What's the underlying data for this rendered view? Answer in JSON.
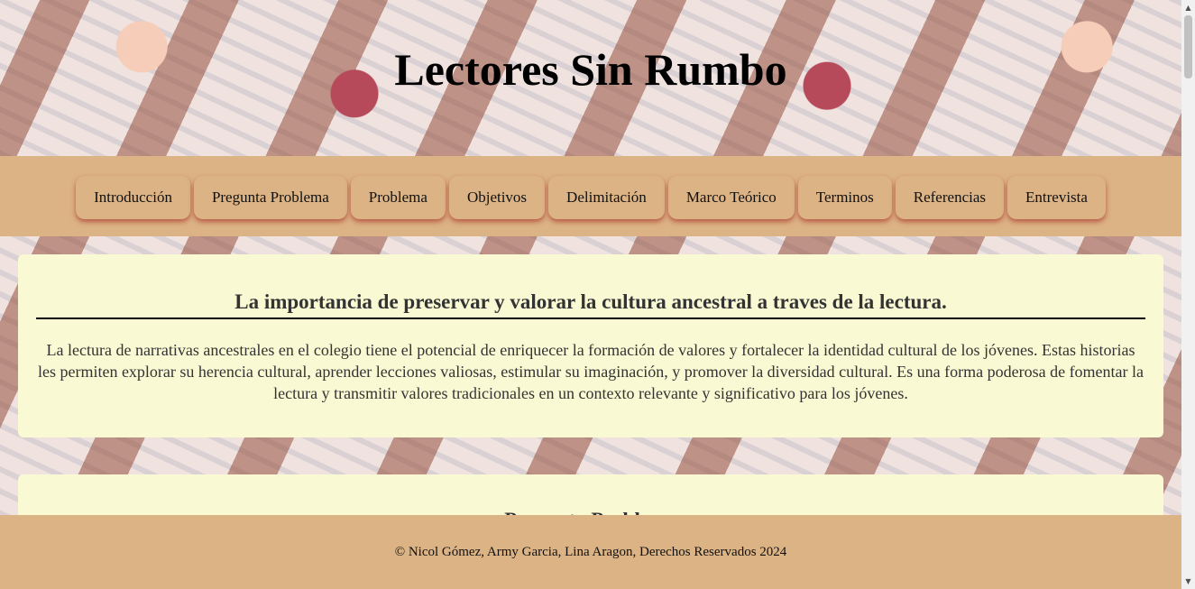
{
  "header": {
    "title": "Lectores Sin Rumbo"
  },
  "nav": {
    "items": [
      "Introducción",
      "Pregunta Problema",
      "Problema",
      "Objetivos",
      "Delimitación",
      "Marco Teórico",
      "Terminos",
      "Referencias",
      "Entrevista"
    ]
  },
  "sections": [
    {
      "heading": "La importancia de preservar y valorar la cultura ancestral a traves de la lectura.",
      "body": "La lectura de narrativas ancestrales en el colegio tiene el potencial de enriquecer la formación de valores y fortalecer la identidad cultural de los jóvenes. Estas historias les permiten explorar su herencia cultural, aprender lecciones valiosas, estimular su imaginación, y promover la diversidad cultural. Es una forma poderosa de fomentar la lectura y transmitir valores tradicionales en un contexto relevante y significativo para los jóvenes."
    },
    {
      "heading": "Pregunta Problema"
    }
  ],
  "footer": {
    "text": "© Nicol Gómez, Army Garcia, Lina Aragon, Derechos Reservados 2024"
  },
  "colors": {
    "nav_background": "#dcb384",
    "card_background": "#f9f9d4",
    "nav_shadow": "#aa3c32"
  }
}
